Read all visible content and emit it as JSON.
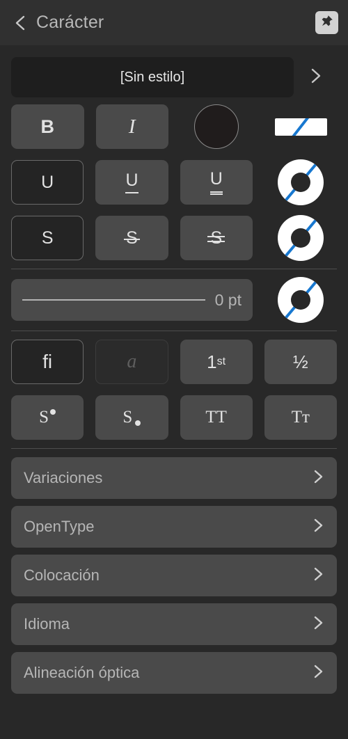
{
  "header": {
    "title": "Carácter",
    "back_icon": "chevron-left-icon",
    "pin_icon": "pin-icon"
  },
  "style": {
    "value": "[Sin estilo]",
    "arrow_icon": "chevron-right-icon"
  },
  "format_rows": [
    {
      "name": "weight-style-row",
      "buttons": [
        {
          "name": "bold-button",
          "label": "B",
          "state": "normal"
        },
        {
          "name": "italic-button",
          "label": "I",
          "state": "normal"
        }
      ],
      "swatch": {
        "name": "text-color-swatch",
        "type": "circle"
      },
      "widget": {
        "name": "text-decoration-color-none",
        "type": "bar-none"
      }
    },
    {
      "name": "underline-row",
      "buttons": [
        {
          "name": "underline-none-button",
          "label": "U",
          "state": "selected"
        },
        {
          "name": "underline-single-button",
          "label": "U",
          "state": "normal"
        },
        {
          "name": "underline-double-button",
          "label": "U",
          "state": "normal"
        }
      ],
      "widget": {
        "name": "underline-color-none",
        "type": "donut-none"
      }
    },
    {
      "name": "strikethrough-row",
      "buttons": [
        {
          "name": "strikethrough-none-button",
          "label": "S",
          "state": "selected"
        },
        {
          "name": "strikethrough-single-button",
          "label": "S",
          "state": "normal"
        },
        {
          "name": "strikethrough-double-button",
          "label": "S",
          "state": "normal"
        }
      ],
      "widget": {
        "name": "strikethrough-color-none",
        "type": "donut-none"
      }
    }
  ],
  "slider": {
    "name": "decoration-width-slider",
    "value": "0 pt",
    "widget": {
      "name": "decoration-fill-color-none",
      "type": "donut-none"
    }
  },
  "typography_rows": [
    {
      "name": "ligature-row",
      "buttons": [
        {
          "name": "standard-ligatures-button",
          "label": "fi",
          "state": "selected"
        },
        {
          "name": "discretionary-ligatures-button",
          "label": "a",
          "state": "disabled"
        },
        {
          "name": "ordinals-button",
          "label": "1",
          "sup": "st",
          "state": "normal"
        },
        {
          "name": "fractions-button",
          "label": "½",
          "state": "normal"
        }
      ]
    },
    {
      "name": "position-case-row",
      "buttons": [
        {
          "name": "superscript-button",
          "label": "S",
          "state": "normal"
        },
        {
          "name": "subscript-button",
          "label": "S",
          "state": "normal"
        },
        {
          "name": "all-caps-button",
          "label": "TT",
          "state": "normal"
        },
        {
          "name": "small-caps-button",
          "label": "Tᴛ",
          "state": "normal"
        }
      ]
    }
  ],
  "menu_items": [
    {
      "name": "menu-item-variaciones",
      "label": "Variaciones",
      "arrow_icon": "chevron-right-icon"
    },
    {
      "name": "menu-item-opentype",
      "label": "OpenType",
      "arrow_icon": "chevron-right-icon"
    },
    {
      "name": "menu-item-colocacion",
      "label": "Colocación",
      "arrow_icon": "chevron-right-icon"
    },
    {
      "name": "menu-item-idioma",
      "label": "Idioma",
      "arrow_icon": "chevron-right-icon"
    },
    {
      "name": "menu-item-alineacion-optica",
      "label": "Alineación óptica",
      "arrow_icon": "chevron-right-icon"
    }
  ],
  "colors": {
    "background": "#282828",
    "header": "#303030",
    "button": "#4a4a4a",
    "selected": "#242424",
    "field_dark": "#1e1e1e",
    "accent_blue": "#1878d0",
    "text": "#b8b8b8"
  }
}
